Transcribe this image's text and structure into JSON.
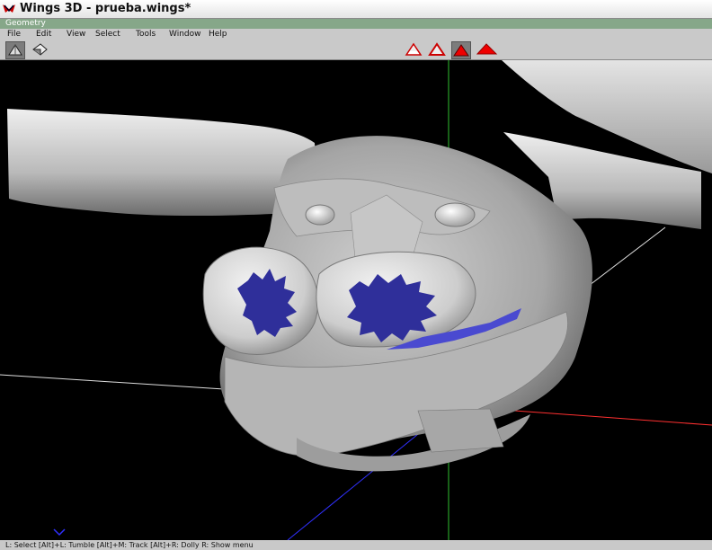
{
  "window": {
    "title": "Wings 3D - prueba.wings*"
  },
  "panel": {
    "title": "Geometry"
  },
  "menu": [
    "File",
    "Edit",
    "View",
    "Select",
    "Tools",
    "Window",
    "Help"
  ],
  "toolbar": {
    "left_buttons": [
      "view-mode-solid-icon",
      "view-mode-wire-icon"
    ],
    "select_modes": [
      "vertex-select-icon",
      "edge-select-icon",
      "face-select-icon",
      "body-select-icon"
    ],
    "active_select_mode": "face"
  },
  "status": {
    "text": "L: Select   [Alt]+L: Tumble   [Alt]+M: Track   [Alt]+R: Dolly   R: Show menu"
  },
  "colors": {
    "selection": "#3333aa",
    "axis_x": "#ff3030",
    "axis_y": "#30c030",
    "axis_z": "#3030ff"
  }
}
